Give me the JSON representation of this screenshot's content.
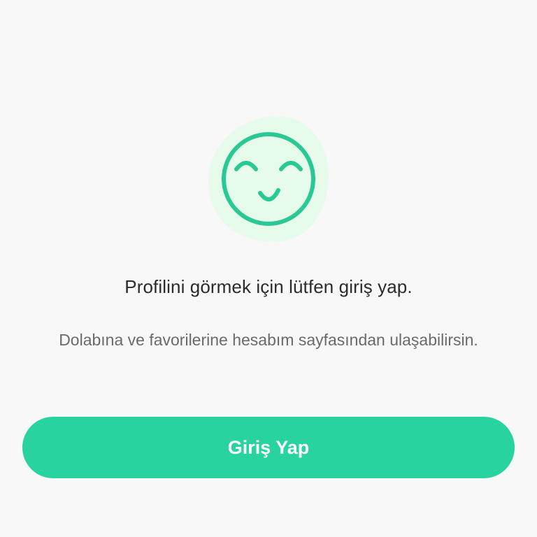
{
  "empty_state": {
    "icon": "smiley-face-icon",
    "title": "Profilini görmek için lütfen giriş yap.",
    "description": "Dolabına ve favorilerine hesabım sayfasından ulaşabilirsin."
  },
  "actions": {
    "login_label": "Giriş Yap"
  },
  "colors": {
    "accent": "#28d3a0",
    "icon_stroke": "#28c995",
    "blob_background": "#e6fbe9",
    "title_text": "#2b2b2b",
    "body_text": "#6a6a6a",
    "page_background": "#f8f8f8"
  }
}
